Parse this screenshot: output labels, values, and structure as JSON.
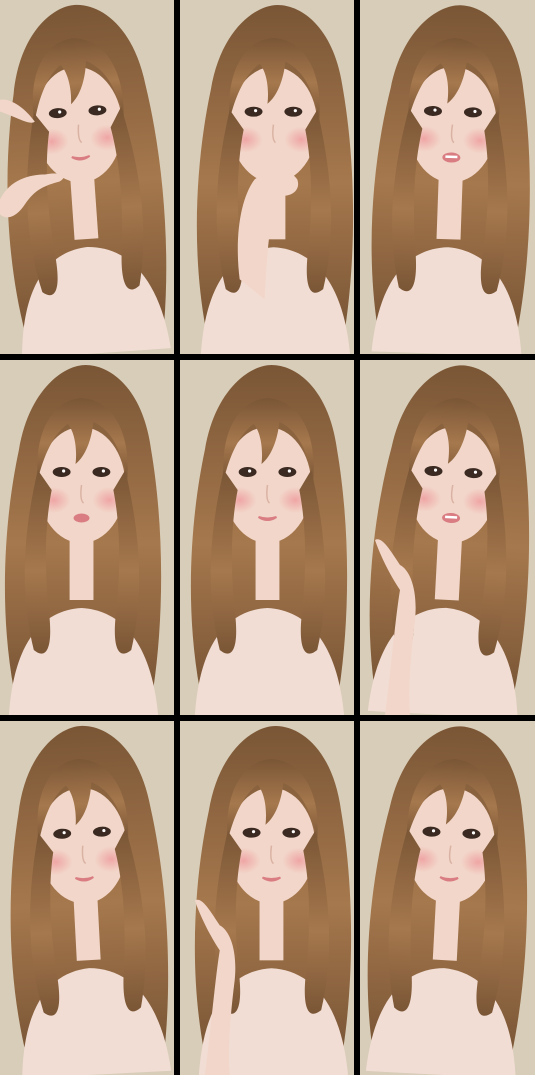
{
  "grid": {
    "rows": 3,
    "columns": 3,
    "divider_color": "#000000"
  },
  "frames": [
    {
      "pose": "head-tilt-left-hand-raised-right",
      "hand": "left"
    },
    {
      "pose": "hand-touching-chin",
      "hand": "center"
    },
    {
      "pose": "lips-parted",
      "hand": "none"
    },
    {
      "pose": "pout-neutral",
      "hand": "none"
    },
    {
      "pose": "neutral-smile",
      "hand": "none"
    },
    {
      "pose": "hand-waving-left",
      "hand": "left-low"
    },
    {
      "pose": "head-tilt-down",
      "hand": "none"
    },
    {
      "pose": "hand-gesture-v",
      "hand": "left-low"
    },
    {
      "pose": "head-tilt-right",
      "hand": "none"
    }
  ],
  "colors": {
    "background_wall": "#d8cdb8",
    "hair": "#7a5636",
    "hair_highlight": "#a6784d",
    "skin": "#f2d6c9",
    "blush": "#ee9a9c",
    "top": "#f1ddd4",
    "lips": "#d97d82"
  }
}
